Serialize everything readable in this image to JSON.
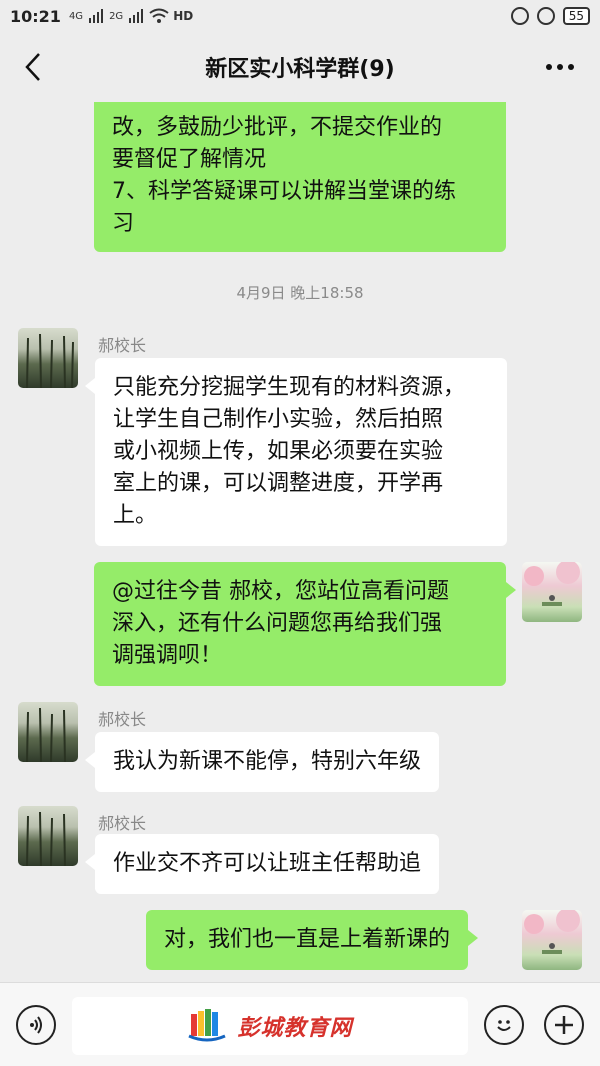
{
  "status_bar": {
    "time": "10:21",
    "signal_1": "4G",
    "signal_2": "2G",
    "hd": "HD",
    "battery": "55"
  },
  "nav": {
    "title": "新区实小科学群(9)",
    "more": "···"
  },
  "messages": {
    "m1": {
      "line1": "改，多鼓励少批评，不提交作业的",
      "line2": "要督促了解情况",
      "line3": "7、科学答疑课可以讲解当堂课的练",
      "line4": "习"
    },
    "timestamp": "4月9日 晚上18:58",
    "m2": {
      "sender": "郝校长",
      "line1": "只能充分挖掘学生现有的材料资源，",
      "line2": "让学生自己制作小实验，然后拍照",
      "line3": "或小视频上传，如果必须要在实验",
      "line4": "室上的课，可以调整进度，开学再",
      "line5": "上。"
    },
    "m3": {
      "line1": "@过往今昔  郝校，您站位高看问题",
      "line2": "深入，还有什么问题您再给我们强",
      "line3": "调强调呗！"
    },
    "m4": {
      "sender": "郝校长",
      "text": "我认为新课不能停，特别六年级"
    },
    "m5": {
      "sender": "郝校长",
      "text": "作业交不齐可以让班主任帮助追"
    },
    "m6": {
      "text": "对，我们也一直是上着新课的"
    }
  },
  "input_bar": {
    "watermark": "彭城教育网"
  },
  "colors": {
    "self_bubble": "#95ec69",
    "other_bubble": "#ffffff",
    "background": "#ededed",
    "watermark": "#d6322c"
  }
}
